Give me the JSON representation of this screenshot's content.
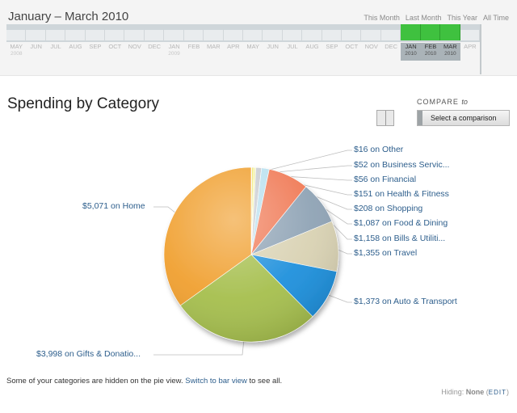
{
  "header": {
    "range_title": "January – March 2010",
    "quick_links": [
      "This Month",
      "Last Month",
      "This Year",
      "All Time"
    ],
    "months": [
      {
        "m": "MAY",
        "y": "2008",
        "sel": false
      },
      {
        "m": "JUN",
        "y": "",
        "sel": false
      },
      {
        "m": "JUL",
        "y": "",
        "sel": false
      },
      {
        "m": "AUG",
        "y": "",
        "sel": false
      },
      {
        "m": "SEP",
        "y": "",
        "sel": false
      },
      {
        "m": "OCT",
        "y": "",
        "sel": false
      },
      {
        "m": "NOV",
        "y": "",
        "sel": false
      },
      {
        "m": "DEC",
        "y": "",
        "sel": false
      },
      {
        "m": "JAN",
        "y": "2009",
        "sel": false
      },
      {
        "m": "FEB",
        "y": "",
        "sel": false
      },
      {
        "m": "MAR",
        "y": "",
        "sel": false
      },
      {
        "m": "APR",
        "y": "",
        "sel": false
      },
      {
        "m": "MAY",
        "y": "",
        "sel": false
      },
      {
        "m": "JUN",
        "y": "",
        "sel": false
      },
      {
        "m": "JUL",
        "y": "",
        "sel": false
      },
      {
        "m": "AUG",
        "y": "",
        "sel": false
      },
      {
        "m": "SEP",
        "y": "",
        "sel": false
      },
      {
        "m": "OCT",
        "y": "",
        "sel": false
      },
      {
        "m": "NOV",
        "y": "",
        "sel": false
      },
      {
        "m": "DEC",
        "y": "",
        "sel": false
      },
      {
        "m": "JAN",
        "y": "2010",
        "sel": true
      },
      {
        "m": "FEB",
        "y": "2010",
        "sel": true
      },
      {
        "m": "MAR",
        "y": "2010",
        "sel": true
      },
      {
        "m": "APR",
        "y": "",
        "sel": false
      }
    ]
  },
  "main": {
    "title": "Spending by Category",
    "compare_label": "COMPARE",
    "compare_to": "to",
    "compare_button": "Select a comparison",
    "hidden_note": "Some of your categories are hidden on the pie view.",
    "switch_link": "Switch to bar view",
    "hidden_note_tail": "to see all.",
    "hiding_label": "Hiding:",
    "hiding_value": "None",
    "edit_label": "EDIT"
  },
  "chart_data": {
    "type": "pie",
    "categories": [
      "Home",
      "Gifts & Donations",
      "Auto & Transport",
      "Travel",
      "Bills & Utilities",
      "Food & Dining",
      "Shopping",
      "Health & Fitness",
      "Financial",
      "Business Services",
      "Other"
    ],
    "values": [
      5071,
      3998,
      1373,
      1355,
      1158,
      1087,
      208,
      151,
      56,
      52,
      16
    ],
    "labels": [
      "$5,071 on Home",
      "$3,998 on Gifts & Donatio...",
      "$1,373 on Auto & Transport",
      "$1,355 on Travel",
      "$1,158 on Bills & Utiliti...",
      "$1,087 on Food & Dining",
      "$208 on Shopping",
      "$151 on Health & Fitness",
      "$56 on Financial",
      "$52 on Business Servic...",
      "$16 on Other"
    ],
    "colors": [
      "#f0a030",
      "#a6bf4e",
      "#1e90dc",
      "#d9d2b3",
      "#8fa3b5",
      "#f07a56",
      "#b9e0ef",
      "#c9ccd1",
      "#f1f1a8",
      "#efe86d",
      "#e2e07b"
    ]
  }
}
